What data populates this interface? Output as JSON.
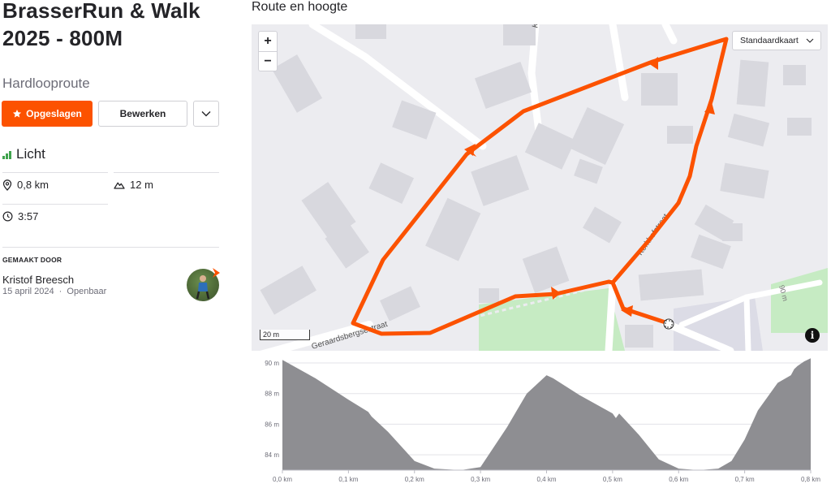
{
  "route": {
    "title_line1": "BrasserRun & Walk",
    "title_line2": "2025 - 800M",
    "type": "Hardlooproute"
  },
  "actions": {
    "saved_label": "Opgeslagen",
    "edit_label": "Bewerken",
    "more_icon": "chevron-down-icon"
  },
  "difficulty": {
    "label": "Licht",
    "icon": "difficulty-bars-icon"
  },
  "stats": {
    "distance": "0,8 km",
    "elevation": "12 m",
    "time": "3:57"
  },
  "creator": {
    "heading": "GEMAAKT DOOR",
    "name": "Kristof Breesch",
    "date": "15 april 2024",
    "separator": "·",
    "visibility": "Openbaar"
  },
  "map": {
    "title": "Route en hoogte",
    "zoom_in": "+",
    "zoom_out": "−",
    "map_type": "Standaardkaart",
    "scale": "20 m",
    "info": "i",
    "streets": [
      "Kerkhofstraat",
      "Geraardsbergsestraat",
      "Ke",
      "90 m"
    ],
    "route_color": "#fc5200"
  },
  "chart_data": {
    "type": "area",
    "title": "",
    "xlabel": "",
    "ylabel": "",
    "xlim": [
      0,
      0.8
    ],
    "ylim": [
      83,
      90
    ],
    "y_ticks": [
      {
        "value": 84,
        "label": "84 m"
      },
      {
        "value": 86,
        "label": "86 m"
      },
      {
        "value": 88,
        "label": "88 m"
      },
      {
        "value": 90,
        "label": "90 m"
      }
    ],
    "x_ticks": [
      {
        "value": 0.0,
        "label": "0,0 km"
      },
      {
        "value": 0.1,
        "label": "0,1 km"
      },
      {
        "value": 0.2,
        "label": "0,2 km"
      },
      {
        "value": 0.3,
        "label": "0,3 km"
      },
      {
        "value": 0.4,
        "label": "0,4 km"
      },
      {
        "value": 0.5,
        "label": "0,5 km"
      },
      {
        "value": 0.6,
        "label": "0,6 km"
      },
      {
        "value": 0.7,
        "label": "0,7 km"
      },
      {
        "value": 0.8,
        "label": "0,8 km"
      }
    ],
    "series": [
      {
        "color": "#8e8e92",
        "points": [
          [
            0.0,
            90.2
          ],
          [
            0.05,
            89.0
          ],
          [
            0.1,
            87.6
          ],
          [
            0.13,
            86.8
          ],
          [
            0.135,
            86.5
          ],
          [
            0.16,
            85.5
          ],
          [
            0.2,
            83.6
          ],
          [
            0.23,
            83.1
          ],
          [
            0.27,
            83.0
          ],
          [
            0.3,
            83.2
          ],
          [
            0.34,
            85.8
          ],
          [
            0.37,
            88.0
          ],
          [
            0.4,
            89.2
          ],
          [
            0.41,
            89.0
          ],
          [
            0.45,
            87.9
          ],
          [
            0.5,
            86.7
          ],
          [
            0.505,
            86.4
          ],
          [
            0.51,
            86.7
          ],
          [
            0.54,
            85.3
          ],
          [
            0.57,
            83.7
          ],
          [
            0.6,
            83.1
          ],
          [
            0.63,
            83.0
          ],
          [
            0.66,
            83.1
          ],
          [
            0.68,
            83.6
          ],
          [
            0.7,
            85.0
          ],
          [
            0.72,
            86.9
          ],
          [
            0.75,
            88.7
          ],
          [
            0.77,
            89.2
          ],
          [
            0.775,
            89.6
          ],
          [
            0.78,
            89.8
          ],
          [
            0.79,
            90.1
          ],
          [
            0.8,
            90.3
          ]
        ]
      }
    ],
    "grid": true
  }
}
